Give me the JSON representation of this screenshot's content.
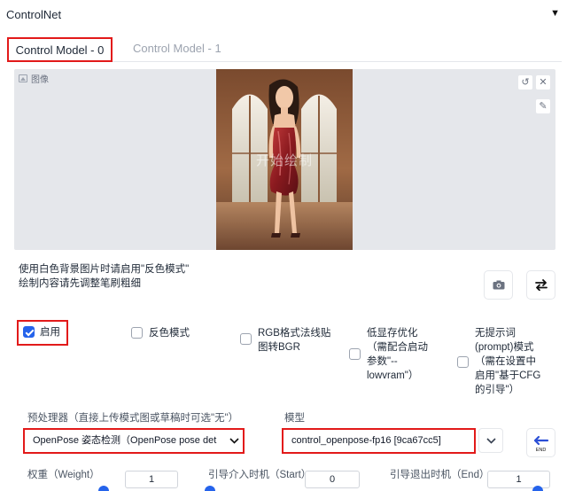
{
  "panel": {
    "title": "ControlNet",
    "collapse_icon": "triangle-down-icon"
  },
  "tabs": [
    {
      "label": "Control Model - 0",
      "active": true
    },
    {
      "label": "Control Model - 1",
      "active": false
    }
  ],
  "image": {
    "label": "图像",
    "overlay_text": "开始绘制"
  },
  "hint": {
    "line1": "使用白色背景图片时请启用\"反色模式\"",
    "line2": "绘制内容请先调整笔刷粗细"
  },
  "checkboxes": {
    "enable": {
      "label": "启用",
      "checked": true
    },
    "invert": {
      "label": "反色模式",
      "checked": false
    },
    "rgb_bgr": {
      "line1": "RGB格式法线贴",
      "line2": "图转BGR",
      "checked": false
    },
    "lowvram": {
      "line1": "低显存优化",
      "line2": "（需配合启动",
      "line3": "参数\"--",
      "line4": "lowvram\"）",
      "checked": false
    },
    "guess": {
      "line1": "无提示词",
      "line2": "(prompt)模式",
      "line3": "（需在设置中",
      "line4": "启用\"基于CFG",
      "line5": "的引导\"）",
      "checked": false
    }
  },
  "preprocessor": {
    "label": "预处理器（直接上传模式图或草稿时可选\"无\"）",
    "value": "OpenPose 姿态检测（OpenPose pose det"
  },
  "model": {
    "label": "模型",
    "value": "control_openpose-fp16 [9ca67cc5]"
  },
  "sliders": {
    "weight": {
      "label": "权重（Weight）",
      "value": "1"
    },
    "start": {
      "label": "引导介入时机（Start）",
      "value": "0"
    },
    "end": {
      "label": "引导退出时机（End）",
      "value": "1"
    }
  },
  "colors": {
    "accent": "#2563eb",
    "highlight": "#e21a1a"
  }
}
